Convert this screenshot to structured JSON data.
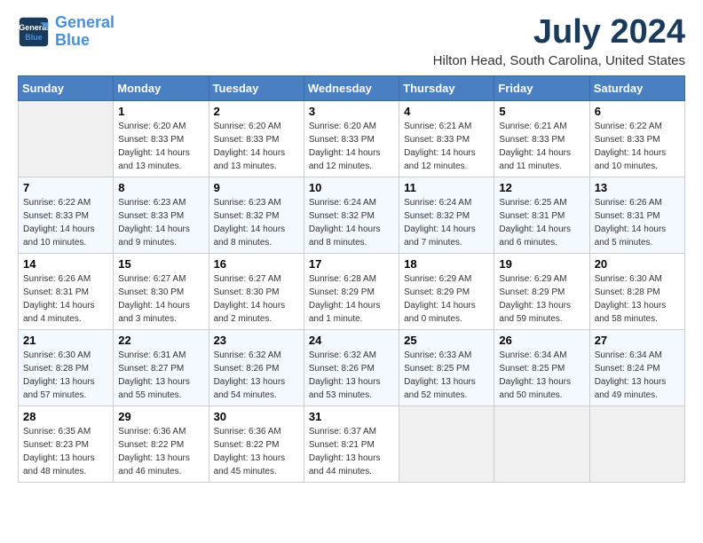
{
  "header": {
    "logo_line1": "General",
    "logo_line2": "Blue",
    "month_title": "July 2024",
    "location": "Hilton Head, South Carolina, United States"
  },
  "weekdays": [
    "Sunday",
    "Monday",
    "Tuesday",
    "Wednesday",
    "Thursday",
    "Friday",
    "Saturday"
  ],
  "weeks": [
    [
      {
        "day": "",
        "empty": true
      },
      {
        "day": "1",
        "sunrise": "6:20 AM",
        "sunset": "8:33 PM",
        "daylight": "14 hours and 13 minutes."
      },
      {
        "day": "2",
        "sunrise": "6:20 AM",
        "sunset": "8:33 PM",
        "daylight": "14 hours and 13 minutes."
      },
      {
        "day": "3",
        "sunrise": "6:20 AM",
        "sunset": "8:33 PM",
        "daylight": "14 hours and 12 minutes."
      },
      {
        "day": "4",
        "sunrise": "6:21 AM",
        "sunset": "8:33 PM",
        "daylight": "14 hours and 12 minutes."
      },
      {
        "day": "5",
        "sunrise": "6:21 AM",
        "sunset": "8:33 PM",
        "daylight": "14 hours and 11 minutes."
      },
      {
        "day": "6",
        "sunrise": "6:22 AM",
        "sunset": "8:33 PM",
        "daylight": "14 hours and 10 minutes."
      }
    ],
    [
      {
        "day": "7",
        "sunrise": "6:22 AM",
        "sunset": "8:33 PM",
        "daylight": "14 hours and 10 minutes."
      },
      {
        "day": "8",
        "sunrise": "6:23 AM",
        "sunset": "8:33 PM",
        "daylight": "14 hours and 9 minutes."
      },
      {
        "day": "9",
        "sunrise": "6:23 AM",
        "sunset": "8:32 PM",
        "daylight": "14 hours and 8 minutes."
      },
      {
        "day": "10",
        "sunrise": "6:24 AM",
        "sunset": "8:32 PM",
        "daylight": "14 hours and 8 minutes."
      },
      {
        "day": "11",
        "sunrise": "6:24 AM",
        "sunset": "8:32 PM",
        "daylight": "14 hours and 7 minutes."
      },
      {
        "day": "12",
        "sunrise": "6:25 AM",
        "sunset": "8:31 PM",
        "daylight": "14 hours and 6 minutes."
      },
      {
        "day": "13",
        "sunrise": "6:26 AM",
        "sunset": "8:31 PM",
        "daylight": "14 hours and 5 minutes."
      }
    ],
    [
      {
        "day": "14",
        "sunrise": "6:26 AM",
        "sunset": "8:31 PM",
        "daylight": "14 hours and 4 minutes."
      },
      {
        "day": "15",
        "sunrise": "6:27 AM",
        "sunset": "8:30 PM",
        "daylight": "14 hours and 3 minutes."
      },
      {
        "day": "16",
        "sunrise": "6:27 AM",
        "sunset": "8:30 PM",
        "daylight": "14 hours and 2 minutes."
      },
      {
        "day": "17",
        "sunrise": "6:28 AM",
        "sunset": "8:29 PM",
        "daylight": "14 hours and 1 minute."
      },
      {
        "day": "18",
        "sunrise": "6:29 AM",
        "sunset": "8:29 PM",
        "daylight": "14 hours and 0 minutes."
      },
      {
        "day": "19",
        "sunrise": "6:29 AM",
        "sunset": "8:29 PM",
        "daylight": "13 hours and 59 minutes."
      },
      {
        "day": "20",
        "sunrise": "6:30 AM",
        "sunset": "8:28 PM",
        "daylight": "13 hours and 58 minutes."
      }
    ],
    [
      {
        "day": "21",
        "sunrise": "6:30 AM",
        "sunset": "8:28 PM",
        "daylight": "13 hours and 57 minutes."
      },
      {
        "day": "22",
        "sunrise": "6:31 AM",
        "sunset": "8:27 PM",
        "daylight": "13 hours and 55 minutes."
      },
      {
        "day": "23",
        "sunrise": "6:32 AM",
        "sunset": "8:26 PM",
        "daylight": "13 hours and 54 minutes."
      },
      {
        "day": "24",
        "sunrise": "6:32 AM",
        "sunset": "8:26 PM",
        "daylight": "13 hours and 53 minutes."
      },
      {
        "day": "25",
        "sunrise": "6:33 AM",
        "sunset": "8:25 PM",
        "daylight": "13 hours and 52 minutes."
      },
      {
        "day": "26",
        "sunrise": "6:34 AM",
        "sunset": "8:25 PM",
        "daylight": "13 hours and 50 minutes."
      },
      {
        "day": "27",
        "sunrise": "6:34 AM",
        "sunset": "8:24 PM",
        "daylight": "13 hours and 49 minutes."
      }
    ],
    [
      {
        "day": "28",
        "sunrise": "6:35 AM",
        "sunset": "8:23 PM",
        "daylight": "13 hours and 48 minutes."
      },
      {
        "day": "29",
        "sunrise": "6:36 AM",
        "sunset": "8:22 PM",
        "daylight": "13 hours and 46 minutes."
      },
      {
        "day": "30",
        "sunrise": "6:36 AM",
        "sunset": "8:22 PM",
        "daylight": "13 hours and 45 minutes."
      },
      {
        "day": "31",
        "sunrise": "6:37 AM",
        "sunset": "8:21 PM",
        "daylight": "13 hours and 44 minutes."
      },
      {
        "day": "",
        "empty": true
      },
      {
        "day": "",
        "empty": true
      },
      {
        "day": "",
        "empty": true
      }
    ]
  ]
}
